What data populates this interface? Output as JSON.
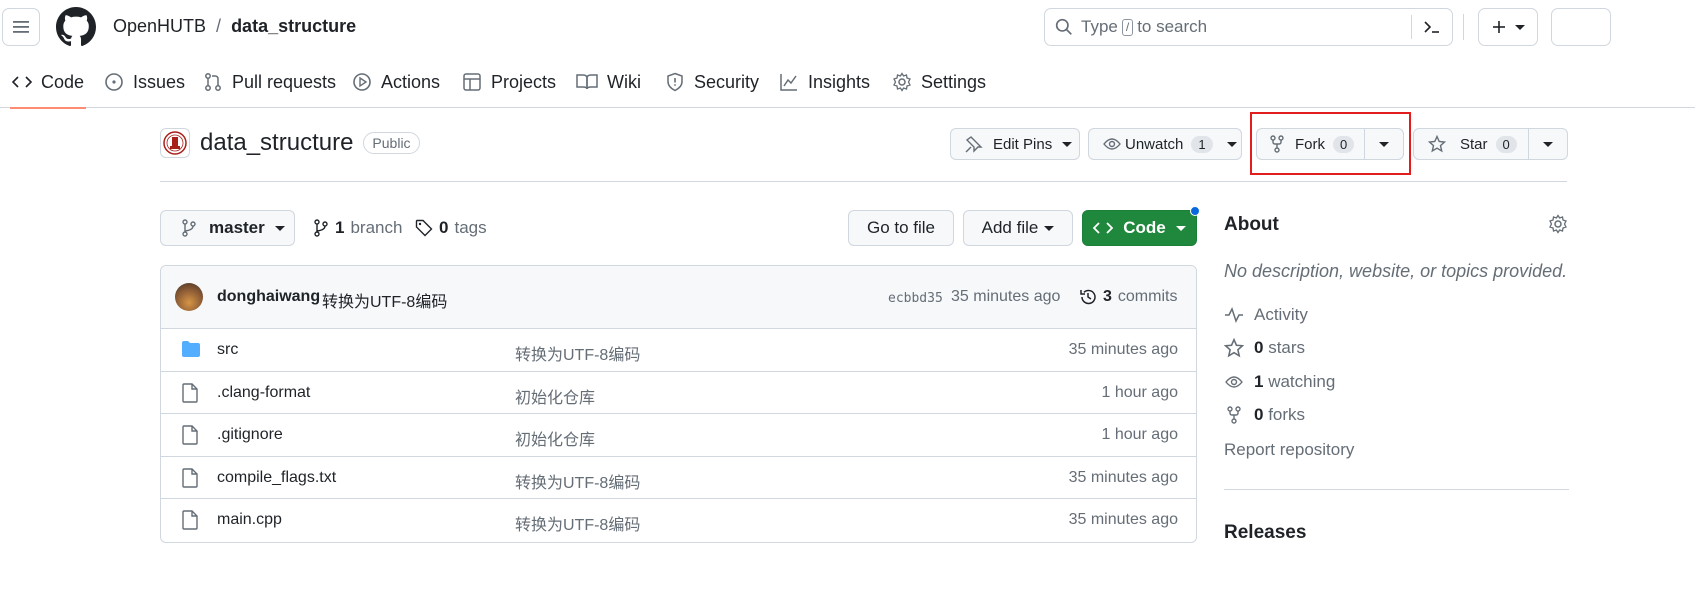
{
  "header": {
    "owner": "OpenHUTB",
    "separator": "/",
    "repo": "data_structure",
    "search_type": "Type",
    "search_key": "/",
    "search_rest": "to search"
  },
  "tabs": [
    {
      "label": "Code",
      "icon": "code-icon",
      "active": true
    },
    {
      "label": "Issues",
      "icon": "issue-icon"
    },
    {
      "label": "Pull requests",
      "icon": "pull-request-icon"
    },
    {
      "label": "Actions",
      "icon": "play-icon"
    },
    {
      "label": "Projects",
      "icon": "table-icon"
    },
    {
      "label": "Wiki",
      "icon": "book-icon"
    },
    {
      "label": "Security",
      "icon": "shield-icon"
    },
    {
      "label": "Insights",
      "icon": "graph-icon"
    },
    {
      "label": "Settings",
      "icon": "gear-icon"
    }
  ],
  "repo_header": {
    "name": "data_structure",
    "visibility": "Public",
    "edit_pins": "Edit Pins",
    "unwatch": "Unwatch",
    "watch_count": "1",
    "fork": "Fork",
    "fork_count": "0",
    "star": "Star",
    "star_count": "0"
  },
  "branch_bar": {
    "branch": "master",
    "branch_count": "1",
    "branch_label": "branch",
    "tag_count": "0",
    "tag_label": "tags",
    "go_to_file": "Go to file",
    "add_file": "Add file",
    "code": "Code"
  },
  "commit": {
    "author": "donghaiwang",
    "message": "转换为UTF-8编码",
    "sha": "ecbbd35",
    "time": "35 minutes ago",
    "count": "3",
    "count_label": "commits"
  },
  "files": [
    {
      "name": "src",
      "type": "folder",
      "message": "转换为UTF-8编码",
      "time": "35 minutes ago"
    },
    {
      "name": ".clang-format",
      "type": "file",
      "message": "初始化仓库",
      "time": "1 hour ago"
    },
    {
      "name": ".gitignore",
      "type": "file",
      "message": "初始化仓库",
      "time": "1 hour ago"
    },
    {
      "name": "compile_flags.txt",
      "type": "file",
      "message": "转换为UTF-8编码",
      "time": "35 minutes ago"
    },
    {
      "name": "main.cpp",
      "type": "file",
      "message": "转换为UTF-8编码",
      "time": "35 minutes ago"
    }
  ],
  "sidebar": {
    "about": "About",
    "description": "No description, website, or topics provided.",
    "activity": "Activity",
    "stars_count": "0",
    "stars_label": "stars",
    "watching_count": "1",
    "watching_label": "watching",
    "forks_count": "0",
    "forks_label": "forks",
    "report": "Report repository",
    "releases": "Releases"
  },
  "colors": {
    "accent_green": "#1f883d",
    "active_tab_underline": "#fd8c73",
    "highlight_box": "#e11d1d",
    "folder_blue": "#54aeff"
  }
}
